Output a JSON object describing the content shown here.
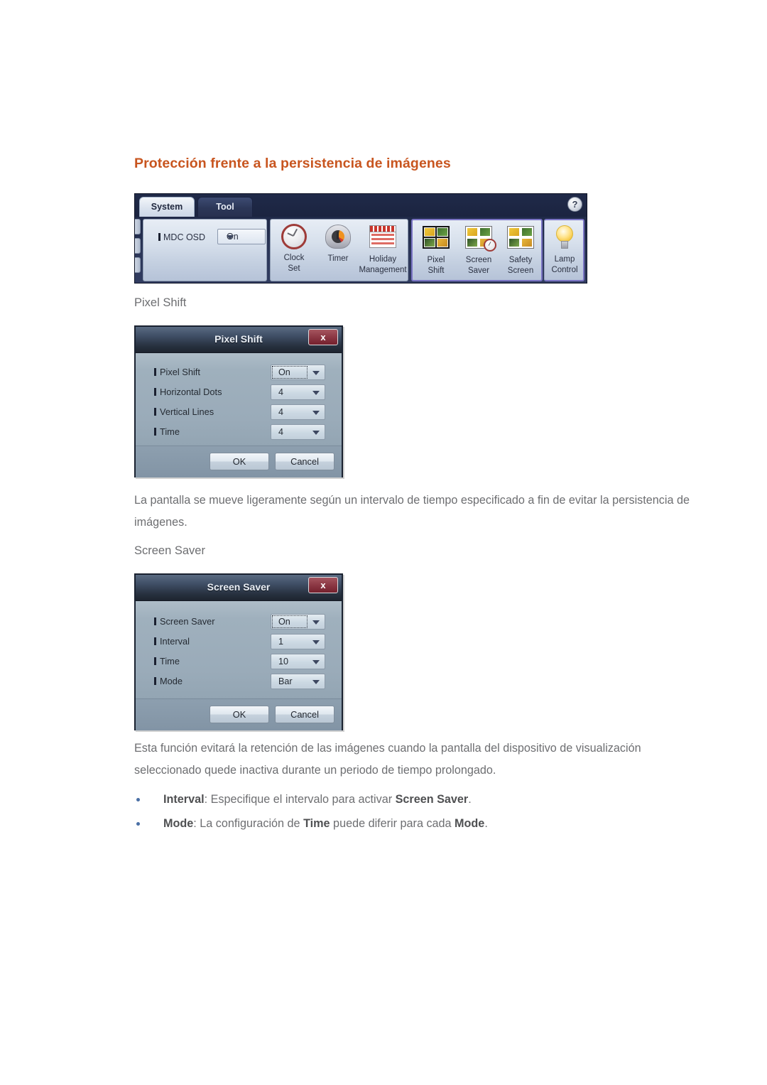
{
  "page": {
    "title": "Protección frente a la persistencia de imágenes"
  },
  "mdc_toolbar": {
    "tabs": [
      {
        "label": "System",
        "active": true
      },
      {
        "label": "Tool",
        "active": false
      }
    ],
    "help_icon": "?",
    "osd": {
      "label": "MDC OSD",
      "value": "On"
    },
    "buttons": [
      {
        "label_line1": "Clock",
        "label_line2": "Set",
        "icon": "clock-icon"
      },
      {
        "label_line1": "Timer",
        "label_line2": "",
        "icon": "timer-icon"
      },
      {
        "label_line1": "Holiday",
        "label_line2": "Management",
        "icon": "calendar-icon"
      },
      {
        "label_line1": "Pixel",
        "label_line2": "Shift",
        "icon": "photo-grid-icon"
      },
      {
        "label_line1": "Screen",
        "label_line2": "Saver",
        "icon": "photo-grid-clock-icon"
      },
      {
        "label_line1": "Safety",
        "label_line2": "Screen",
        "icon": "photo-grid-icon"
      },
      {
        "label_line1": "Lamp",
        "label_line2": "Control",
        "icon": "lightbulb-icon"
      }
    ]
  },
  "sections": [
    {
      "heading": "Pixel Shift",
      "dialog": {
        "title": "Pixel Shift",
        "close_label": "x",
        "rows": [
          {
            "label": "Pixel Shift",
            "value": "On",
            "focused": true
          },
          {
            "label": "Horizontal Dots",
            "value": "4",
            "focused": false
          },
          {
            "label": "Vertical Lines",
            "value": "4",
            "focused": false
          },
          {
            "label": "Time",
            "value": "4",
            "focused": false
          }
        ],
        "ok_label": "OK",
        "cancel_label": "Cancel"
      },
      "paragraph": "La pantalla se mueve ligeramente según un intervalo de tiempo especificado a fin de evitar la persistencia de imágenes."
    },
    {
      "heading": "Screen Saver",
      "dialog": {
        "title": "Screen Saver",
        "close_label": "x",
        "rows": [
          {
            "label": "Screen Saver",
            "value": "On",
            "focused": true
          },
          {
            "label": "Interval",
            "value": "1",
            "focused": false
          },
          {
            "label": "Time",
            "value": "10",
            "focused": false
          },
          {
            "label": "Mode",
            "value": "Bar",
            "focused": false
          }
        ],
        "ok_label": "OK",
        "cancel_label": "Cancel"
      },
      "paragraph": "Esta función evitará la retención de las imágenes cuando la pantalla del dispositivo de visualización seleccionado quede inactiva durante un periodo de tiempo prolongado."
    }
  ],
  "bullets": [
    {
      "term": "Interval",
      "text_before": ": Especifique el intervalo para activar ",
      "emphasis": "Screen Saver",
      "text_after": "."
    },
    {
      "term": "Mode",
      "text_before": ": La configuración de ",
      "emphasis": "Time",
      "text_mid": " puede diferir para cada ",
      "emphasis2": "Mode",
      "text_after": "."
    }
  ],
  "colors": {
    "title": "#c8551f",
    "body_text": "#6d6e71",
    "bullet_dot": "#4a6fa5",
    "highlight_border": "#7a74c4"
  }
}
